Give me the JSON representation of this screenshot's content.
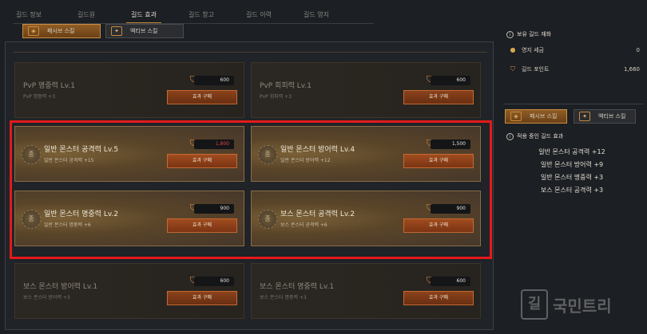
{
  "top_tabs": [
    "길드 정보",
    "길드원",
    "길드 효과",
    "길드 창고",
    "길드 이력",
    "길드 영지"
  ],
  "active_top_tab": 2,
  "skill_tabs": {
    "passive": "패시브 스킬",
    "active": "액티브 스킬"
  },
  "cards": [
    {
      "name": "PvP 명중력 Lv.1",
      "sub": "PvP 명중력 +3",
      "price": "600",
      "buy": "효과 구매"
    },
    {
      "name": "PvP 회피력 Lv.1",
      "sub": "PvP 회피력 +3",
      "price": "600",
      "buy": "효과 구매"
    },
    {
      "name": "일반 몬스터 공격력 Lv.5",
      "sub": "일반 몬스터 공격력 +15",
      "price": "1,800",
      "buy": "효과 구매"
    },
    {
      "name": "일반 몬스터 방어력 Lv.4",
      "sub": "일반 몬스터 방어력 +12",
      "price": "1,500",
      "buy": "효과 구매"
    },
    {
      "name": "일반 몬스터 명중력 Lv.2",
      "sub": "일반 몬스터 명중력 +6",
      "price": "900",
      "buy": "효과 구매"
    },
    {
      "name": "보스 몬스터 공격력 Lv.2",
      "sub": "보스 몬스터 공격력 +6",
      "price": "900",
      "buy": "효과 구매"
    },
    {
      "name": "보스 몬스터 방어력 Lv.1",
      "sub": "보스 몬스터 방어력 +3",
      "price": "600",
      "buy": "효과 구매"
    },
    {
      "name": "보스 몬스터 명중력 Lv.1",
      "sub": "보스 몬스터 명중력 +3",
      "price": "600",
      "buy": "효과 구매"
    }
  ],
  "resources": {
    "title": "보유 길드 재화",
    "items": [
      {
        "label": "영지 세금",
        "value": "0"
      },
      {
        "label": "길드 포인트",
        "value": "1,660"
      }
    ]
  },
  "applied": {
    "title": "적용 중인 길드 효과",
    "items": [
      "일반 몬스터 공격력 +12",
      "일반 몬스터 방어력 +9",
      "일반 몬스터 명중력 +3",
      "보스 몬스터 공격력 +3"
    ]
  },
  "watermark": {
    "logo": "길",
    "text": "국민트리"
  },
  "colors": {
    "accent": "#c88a3a",
    "highlight_border": "#e31a1a",
    "price_red": "#e04040"
  }
}
